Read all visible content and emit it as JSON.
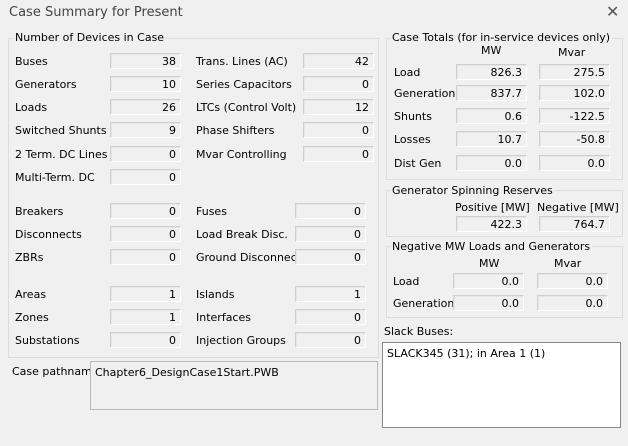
{
  "window": {
    "title": "Case Summary for Present",
    "close_glyph": "✕"
  },
  "devices": {
    "title": "Number of Devices in Case",
    "left": [
      {
        "label": "Buses",
        "value": "38"
      },
      {
        "label": "Generators",
        "value": "10"
      },
      {
        "label": "Loads",
        "value": "26"
      },
      {
        "label": "Switched Shunts",
        "value": "9"
      },
      {
        "label": "2 Term. DC Lines",
        "value": "0"
      },
      {
        "label": "Multi-Term. DC",
        "value": "0"
      }
    ],
    "right": [
      {
        "label": "Trans. Lines (AC)",
        "value": "42"
      },
      {
        "label": "Series Capacitors",
        "value": "0"
      },
      {
        "label": "LTCs (Control Volt)",
        "value": "12"
      },
      {
        "label": "Phase Shifters",
        "value": "0"
      },
      {
        "label": "Mvar Controlling",
        "value": "0"
      }
    ],
    "switching_left": [
      {
        "label": "Breakers",
        "value": "0"
      },
      {
        "label": "Disconnects",
        "value": "0"
      },
      {
        "label": "ZBRs",
        "value": "0"
      }
    ],
    "switching_right": [
      {
        "label": "Fuses",
        "value": "0"
      },
      {
        "label": "Load Break Disc.",
        "value": "0"
      },
      {
        "label": "Ground Disconnects",
        "value": "0"
      }
    ],
    "area_left": [
      {
        "label": "Areas",
        "value": "1"
      },
      {
        "label": "Zones",
        "value": "1"
      },
      {
        "label": "Substations",
        "value": "0"
      }
    ],
    "area_right": [
      {
        "label": "Islands",
        "value": "1"
      },
      {
        "label": "Interfaces",
        "value": "0"
      },
      {
        "label": "Injection Groups",
        "value": "0"
      }
    ]
  },
  "totals": {
    "title": "Case Totals (for in-service devices only)",
    "col_mw": "MW",
    "col_mvar": "Mvar",
    "rows": [
      {
        "label": "Load",
        "mw": "826.3",
        "mvar": "275.5"
      },
      {
        "label": "Generation",
        "mw": "837.7",
        "mvar": "102.0"
      },
      {
        "label": "Shunts",
        "mw": "0.6",
        "mvar": "-122.5"
      },
      {
        "label": "Losses",
        "mw": "10.7",
        "mvar": "-50.8"
      },
      {
        "label": "Dist Gen",
        "mw": "0.0",
        "mvar": "0.0"
      }
    ]
  },
  "reserves": {
    "title": "Generator Spinning Reserves",
    "positive_label": "Positive [MW]",
    "negative_label": "Negative [MW]",
    "positive": "422.3",
    "negative": "764.7"
  },
  "negative_loads": {
    "title": "Negative MW Loads and Generators",
    "col_mw": "MW",
    "col_mvar": "Mvar",
    "rows": [
      {
        "label": "Load",
        "mw": "0.0",
        "mvar": "0.0"
      },
      {
        "label": "Generation",
        "mw": "0.0",
        "mvar": "0.0"
      }
    ]
  },
  "slack": {
    "label": "Slack Buses:",
    "text": "SLACK345 (31); in Area 1 (1)"
  },
  "pathname": {
    "label": "Case pathname",
    "value": "Chapter6_DesignCase1Start.PWB"
  }
}
